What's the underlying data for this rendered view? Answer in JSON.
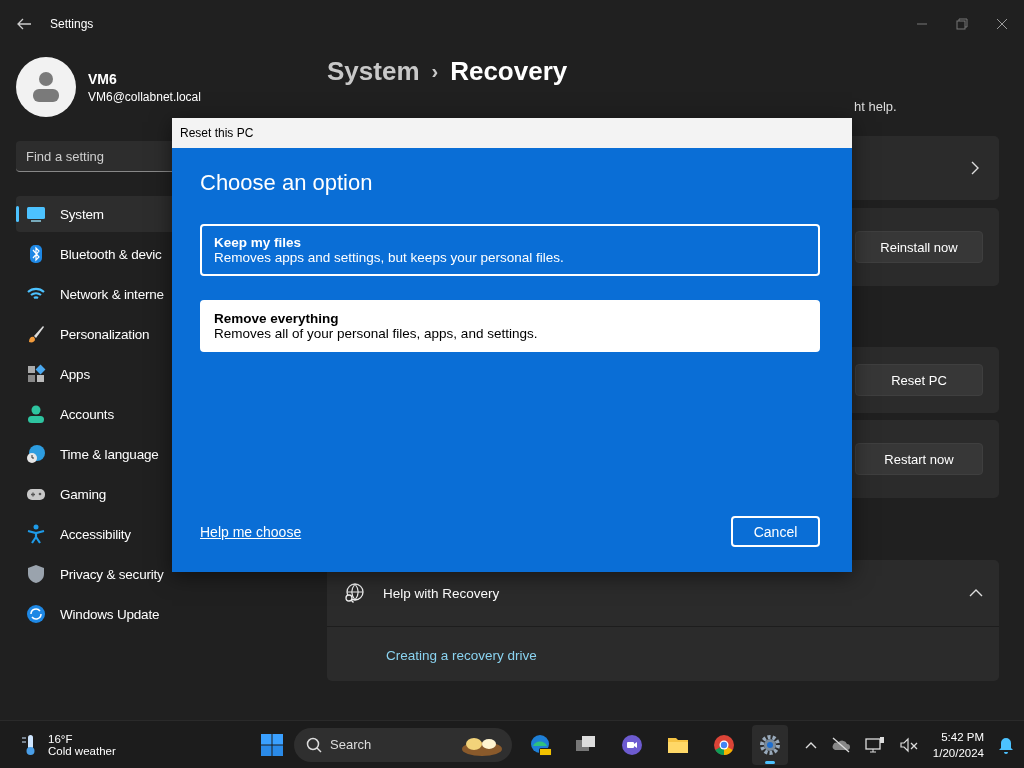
{
  "window": {
    "title": "Settings"
  },
  "user": {
    "name": "VM6",
    "email": "VM6@collabnet.local"
  },
  "search": {
    "placeholder": "Find a setting"
  },
  "nav": [
    {
      "label": "System",
      "kind": "system",
      "selected": true
    },
    {
      "label": "Bluetooth & devic",
      "kind": "bluetooth",
      "selected": false
    },
    {
      "label": "Network & interne",
      "kind": "network",
      "selected": false
    },
    {
      "label": "Personalization",
      "kind": "brush",
      "selected": false
    },
    {
      "label": "Apps",
      "kind": "apps",
      "selected": false
    },
    {
      "label": "Accounts",
      "kind": "accounts",
      "selected": false
    },
    {
      "label": "Time & language",
      "kind": "time",
      "selected": false
    },
    {
      "label": "Gaming",
      "kind": "gaming",
      "selected": false
    },
    {
      "label": "Accessibility",
      "kind": "accessibility",
      "selected": false
    },
    {
      "label": "Privacy & security",
      "kind": "privacy",
      "selected": false
    },
    {
      "label": "Windows Update",
      "kind": "update",
      "selected": false
    }
  ],
  "header": {
    "section": "System",
    "separator": "›",
    "page": "Recovery"
  },
  "description": "ht help.",
  "cards": [
    {
      "kind": "chevron"
    },
    {
      "kind": "button",
      "button": "Reinstall now"
    },
    {
      "kind": "button",
      "button": "Reset PC"
    },
    {
      "kind": "button",
      "button": "Restart now"
    }
  ],
  "related": {
    "title": "Help with Recovery",
    "expanded": true,
    "links": [
      "Creating a recovery drive"
    ]
  },
  "dialog": {
    "title": "Reset this PC",
    "heading": "Choose an option",
    "options": [
      {
        "title": "Keep my files",
        "description": "Removes apps and settings, but keeps your personal files.",
        "selected": true
      },
      {
        "title": "Remove everything",
        "description": "Removes all of your personal files, apps, and settings.",
        "selected": false
      }
    ],
    "help_link": "Help me choose",
    "cancel": "Cancel"
  },
  "taskbar": {
    "weather": {
      "temperature": "16°F",
      "condition": "Cold weather"
    },
    "search": {
      "placeholder": "Search"
    },
    "apps": [
      {
        "kind": "edge",
        "active": false
      },
      {
        "kind": "taskview",
        "active": false
      },
      {
        "kind": "meet",
        "active": false
      },
      {
        "kind": "folder",
        "active": false
      },
      {
        "kind": "chrome",
        "active": false
      },
      {
        "kind": "settings",
        "active": true
      }
    ],
    "clock": {
      "time": "5:42 PM",
      "date": "1/20/2024"
    }
  }
}
